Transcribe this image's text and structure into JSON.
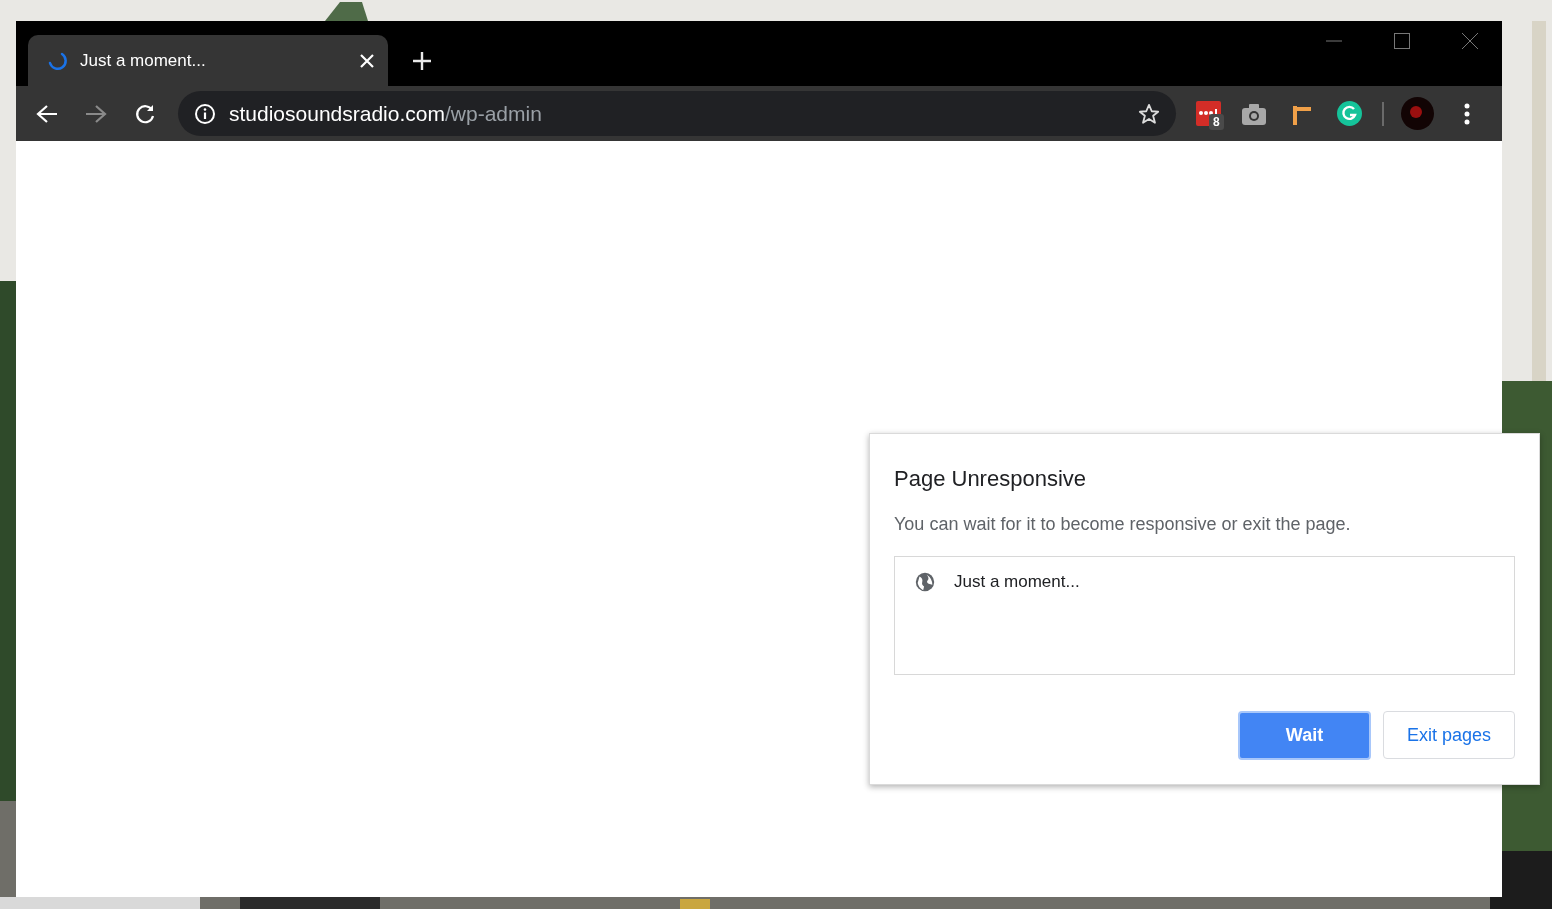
{
  "tab": {
    "title": "Just a moment...",
    "loading": true
  },
  "toolbar": {
    "forward_disabled": true
  },
  "address": {
    "host": "studiosoundsradio.com",
    "path": "/wp-admin"
  },
  "extension_badge": "8",
  "dialog": {
    "title": "Page Unresponsive",
    "message": "You can wait for it to become responsive or exit the page.",
    "pages": [
      "Just a moment..."
    ],
    "buttons": [
      {
        "label": "Wait",
        "primary": true
      },
      {
        "label": "Exit pages",
        "primary": false
      }
    ]
  }
}
